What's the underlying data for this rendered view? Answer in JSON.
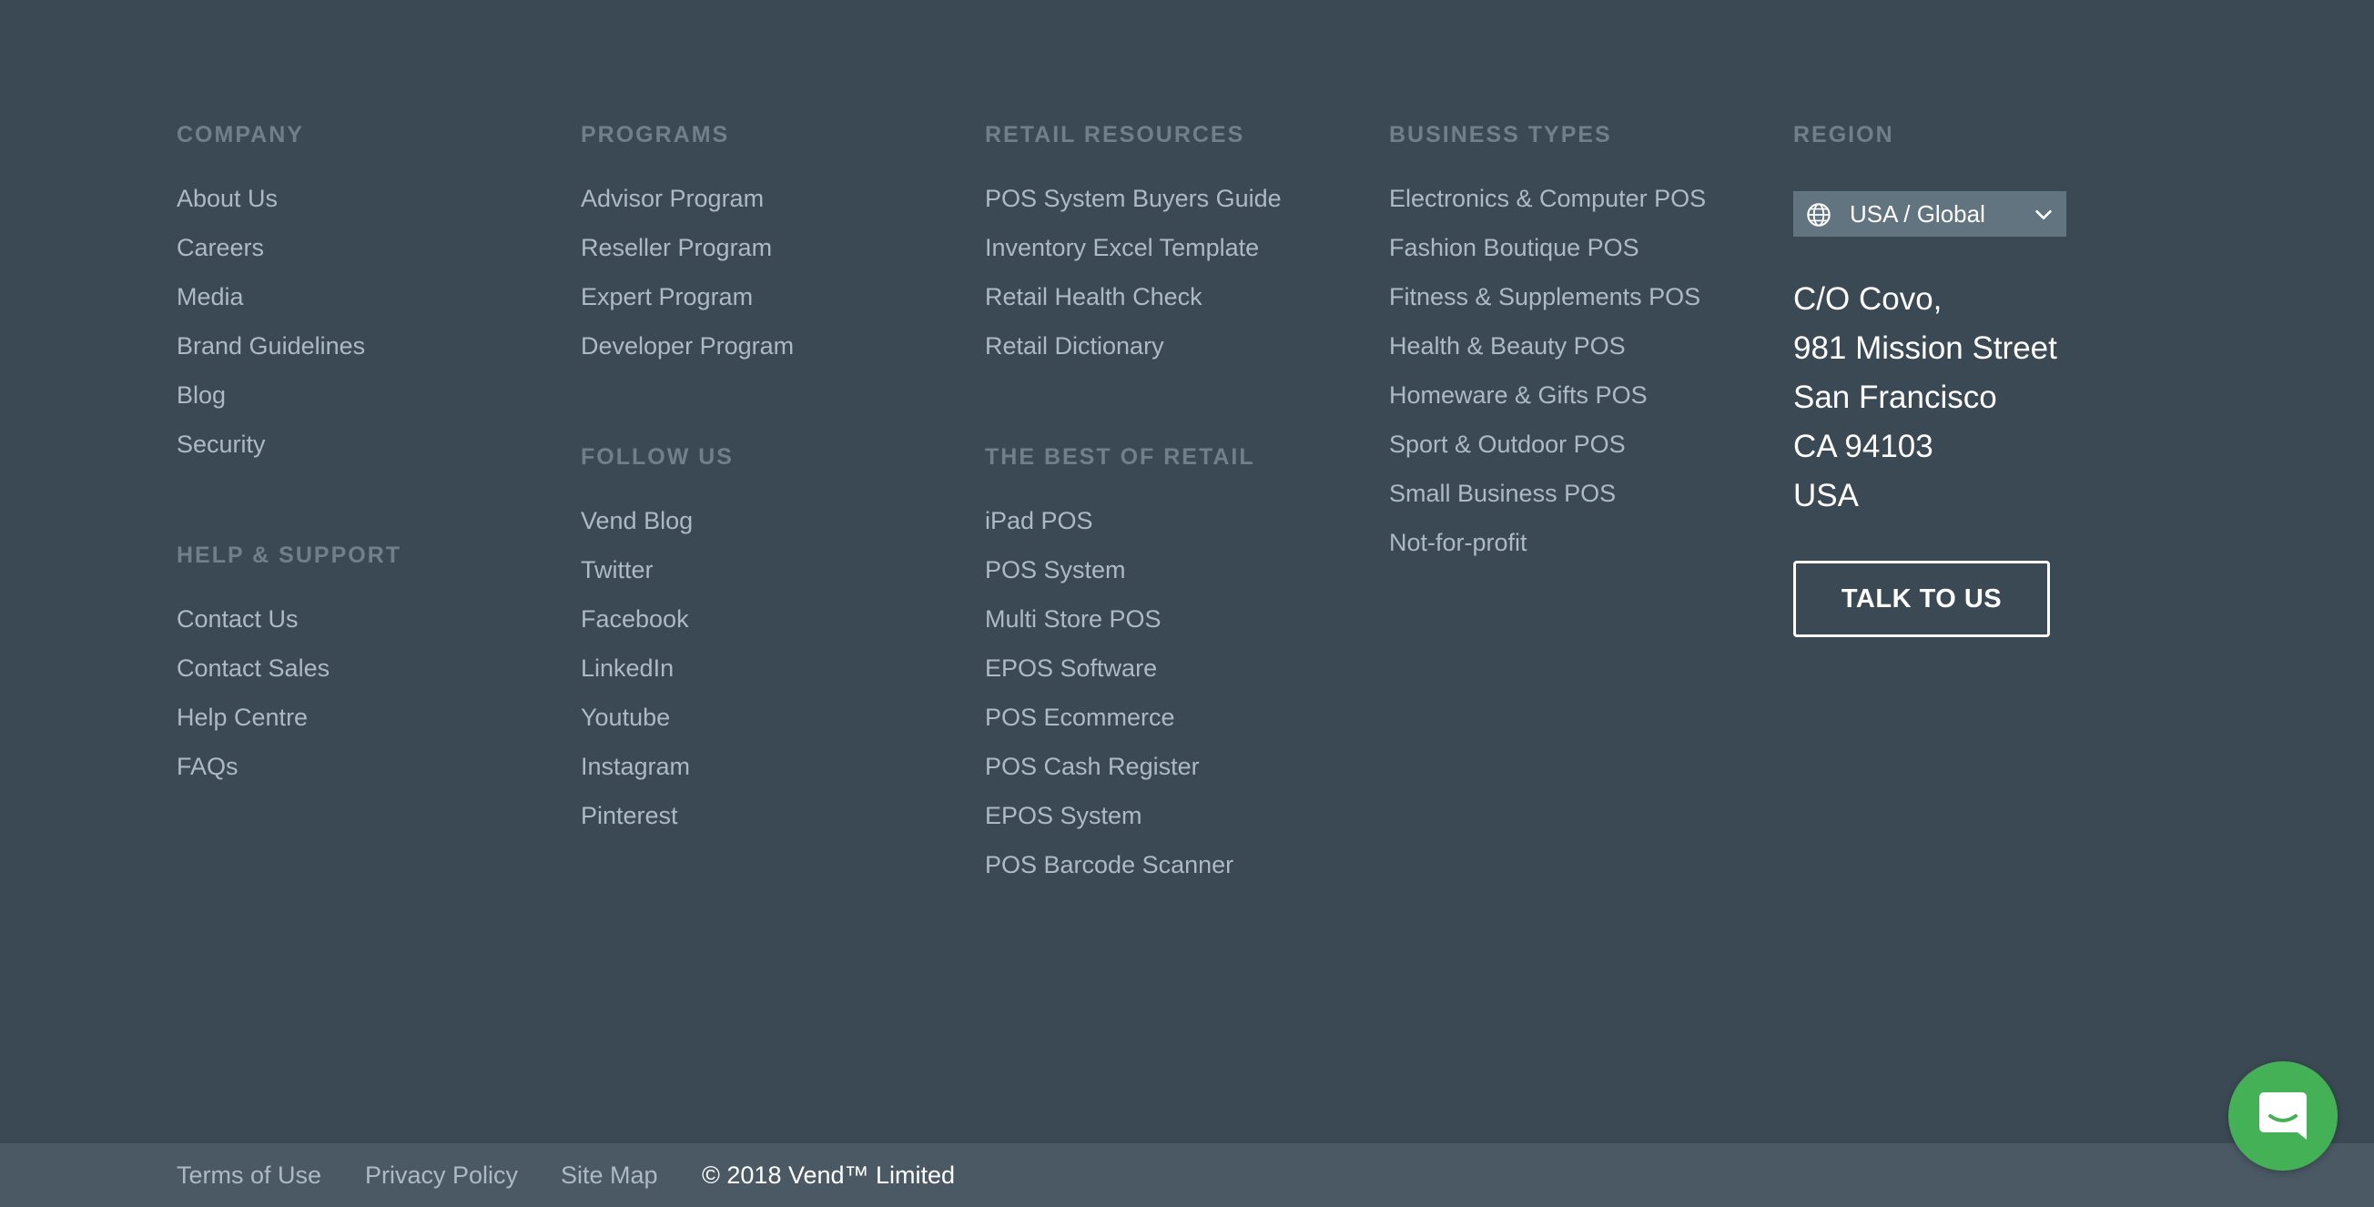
{
  "company": {
    "heading": "COMPANY",
    "links": [
      "About Us",
      "Careers",
      "Media",
      "Brand Guidelines",
      "Blog",
      "Security"
    ]
  },
  "help": {
    "heading": "HELP & SUPPORT",
    "links": [
      "Contact Us",
      "Contact Sales",
      "Help Centre",
      "FAQs"
    ]
  },
  "programs": {
    "heading": "PROGRAMS",
    "links": [
      "Advisor Program",
      "Reseller Program",
      "Expert Program",
      "Developer Program"
    ]
  },
  "follow": {
    "heading": "FOLLOW US",
    "links": [
      "Vend Blog",
      "Twitter",
      "Facebook",
      "LinkedIn",
      "Youtube",
      "Instagram",
      "Pinterest"
    ]
  },
  "resources": {
    "heading": "RETAIL RESOURCES",
    "links": [
      "POS System Buyers Guide",
      "Inventory Excel Template",
      "Retail Health Check",
      "Retail Dictionary"
    ]
  },
  "best": {
    "heading": "THE BEST OF RETAIL",
    "links": [
      "iPad POS",
      "POS System",
      "Multi Store POS",
      "EPOS Software",
      "POS Ecommerce",
      "POS Cash Register",
      "EPOS System",
      "POS Barcode Scanner"
    ]
  },
  "business": {
    "heading": "BUSINESS TYPES",
    "links": [
      "Electronics & Computer POS",
      "Fashion Boutique POS",
      "Fitness & Supplements POS",
      "Health & Beauty POS",
      "Homeware & Gifts POS",
      "Sport & Outdoor POS",
      "Small Business POS",
      "Not-for-profit"
    ]
  },
  "region": {
    "heading": "REGION",
    "selected": "USA / Global",
    "icon": "globe-icon",
    "address": [
      "C/O Covo,",
      "981 Mission Street",
      "San Francisco",
      "CA 94103",
      "USA"
    ],
    "cta_label": "TALK TO US"
  },
  "bottom": {
    "terms": "Terms of Use",
    "privacy": "Privacy Policy",
    "sitemap": "Site Map",
    "copyright": "© 2018 Vend™ Limited"
  },
  "chat": {
    "icon": "chat-bubble-icon"
  },
  "colors": {
    "background": "#3b4954",
    "bottom_bar": "#4a5964",
    "heading": "#6f808c",
    "link": "#aebac3",
    "region_select": "#617480",
    "chat_green": "#45b157"
  }
}
